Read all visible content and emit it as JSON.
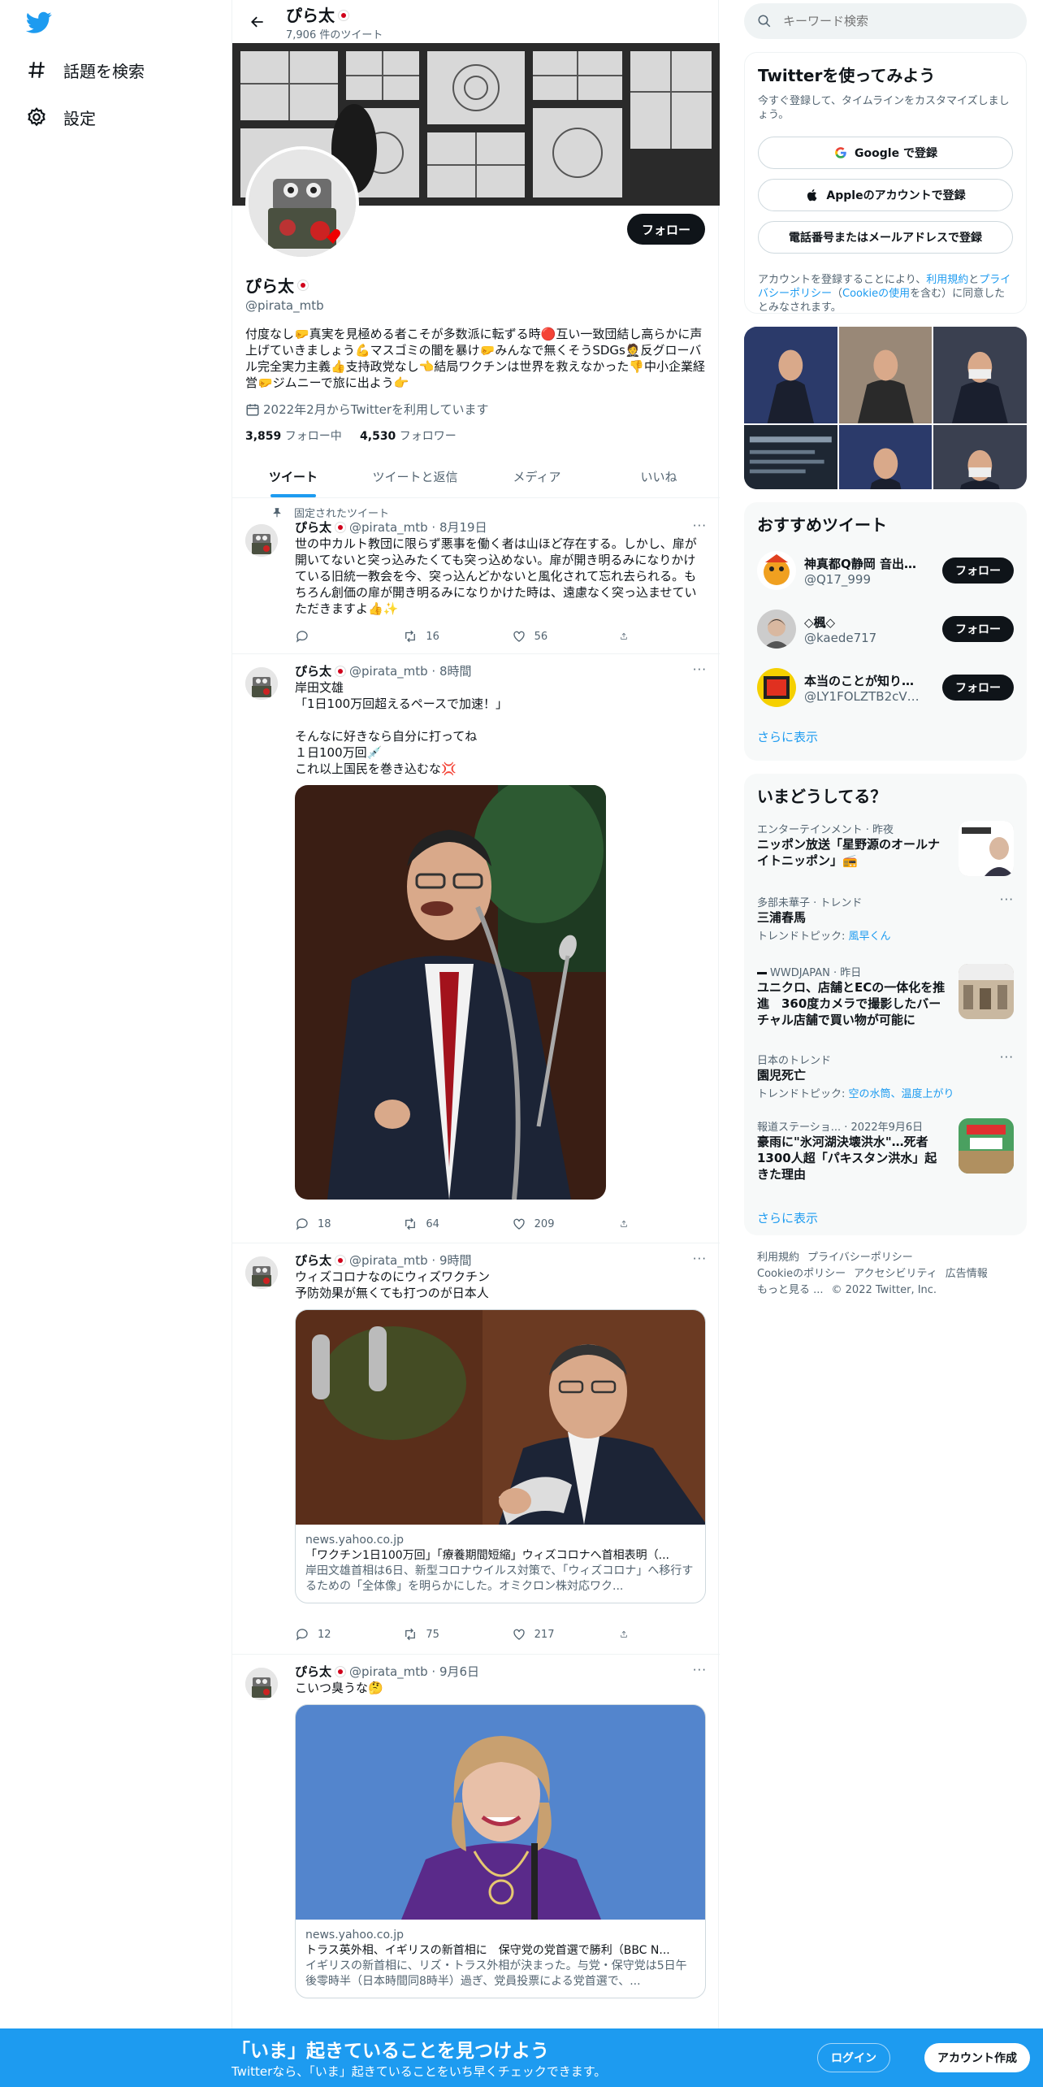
{
  "nav": {
    "explore_label": "話題を検索",
    "settings_label": "設定"
  },
  "profile": {
    "top_name": "ぴら太",
    "tweet_count": "7,906 件のツイート",
    "follow_label": "フォロー",
    "name": "ぴら太",
    "handle": "@pirata_mtb",
    "bio": "付度なし🤛真実を見極める者こそが多数派に転ずる時🔴互い一致団結し高らかに声上げていきましょう💪マスゴミの闇を暴け🤛みんなで無くそうSDGs🤵反グローバル完全実力主義👍支持政党なし👈結局ワクチンは世界を救えなかった👎中小企業経営🤛ジムニーで旅に出よう👉",
    "joined": "2022年2月からTwitterを利用しています",
    "following_count": "3,859",
    "following_label": "フォロー中",
    "followers_count": "4,530",
    "followers_label": "フォロワー"
  },
  "tabs": [
    "ツイート",
    "ツイートと返信",
    "メディア",
    "いいね"
  ],
  "tweets": [
    {
      "pinned_label": "固定されたツイート",
      "name": "ぴら太",
      "meta": "@pirata_mtb · 8月19日",
      "text": "世の中カルト教団に限らず悪事を働く者は山ほど存在する。しかし、扉が開いてないと突っ込みたくても突っ込めない。扉が開き明るみになりかけている旧統一教会を今、突っ込んどかないと風化されて忘れ去られる。もちろん創価の扉が開き明るみになりかけた時は、遠慮なく突っ込ませていただきますよ👍✨",
      "replies": "",
      "retweets": "16",
      "likes": "56"
    },
    {
      "name": "ぴら太",
      "meta": "@pirata_mtb · 8時間",
      "text": "岸田文雄\n「1日100万回超えるペースで加速！」\n\nそんなに好きなら自分に打ってね\n１日100万回💉\nこれ以上国民を巻き込むな💢",
      "replies": "18",
      "retweets": "64",
      "likes": "209"
    },
    {
      "name": "ぴら太",
      "meta": "@pirata_mtb · 9時間",
      "text": "ウィズコロナなのにウィズワクチン\n予防効果が無くても打つのが日本人",
      "card_domain": "news.yahoo.co.jp",
      "card_title": "「ワクチン1日100万回」「療養期間短縮」ウィズコロナへ首相表明（...",
      "card_desc": "岸田文雄首相は6日、新型コロナウイルス対策で、「ウィズコロナ」へ移行するための「全体像」を明らかにした。オミクロン株対応ワク...",
      "replies": "12",
      "retweets": "75",
      "likes": "217"
    },
    {
      "name": "ぴら太",
      "meta": "@pirata_mtb · 9月6日",
      "text": "こいつ臭うな🤔",
      "card_domain": "news.yahoo.co.jp",
      "card_title": "トラス英外相、イギリスの新首相に　保守党の党首選で勝利（BBC N...",
      "card_desc": "イギリスの新首相に、リズ・トラス外相が決まった。与党・保守党は5日午後零時半（日本時間同8時半）過ぎ、党員投票による党首選で、..."
    }
  ],
  "search": {
    "placeholder": "キーワード検索"
  },
  "signup": {
    "title": "Twitterを使ってみよう",
    "subtitle": "今すぐ登録して、タイムラインをカスタマイズしましょう。",
    "google_label": "Google で登録",
    "apple_label": "Appleのアカウントで登録",
    "phone_label": "電話番号またはメールアドレスで登録",
    "legal_prefix": "アカウントを登録することにより、",
    "legal_terms": "利用規約",
    "legal_and": "と",
    "legal_privacy": "プライバシーポリシー",
    "legal_paren_open": "（",
    "legal_cookie": "Cookieの使用",
    "legal_suffix": "を含む）に同意したとみなされます。"
  },
  "recommend": {
    "title": "おすすめツイート",
    "users": [
      {
        "name": "神真都Q静岡 音出し隊",
        "handle": "@Q17_999"
      },
      {
        "name": "◇楓◇",
        "handle": "@kaede717"
      },
      {
        "name": "本当のことが知りた...",
        "handle": "@LY1FOLZTB2cVC..."
      }
    ],
    "follow_label": "フォロー",
    "show_more": "さらに表示"
  },
  "trends": {
    "title": "いまどうしてる？",
    "items": [
      {
        "context": "エンターテインメント · 昨夜",
        "title": "ニッポン放送「星野源のオールナイトニッポン」📻"
      },
      {
        "context": "多部未華子 · トレンド",
        "title": "三浦春馬",
        "topic_prefix": "トレンドトピック: ",
        "topic": "風早くん"
      },
      {
        "context": "WWDJAPAN · 昨日",
        "title": "ユニクロ、店舗とECの一体化を推進　360度カメラで撮影したバーチャル店舗で買い物が可能に"
      },
      {
        "context": "日本のトレンド",
        "title": "園児死亡",
        "topic_prefix": "トレンドトピック: ",
        "topic": "空の水筒、温度上がり"
      },
      {
        "context": "報道ステーショ... · 2022年9月6日",
        "title": "豪雨に\"氷河湖決壊洪水\"…死者1300人超「パキスタン洪水」起きた理由"
      }
    ],
    "show_more": "さらに表示"
  },
  "footer": {
    "terms": "利用規約",
    "privacy": "プライバシーポリシー",
    "cookie": "Cookieのポリシー",
    "accessibility": "アクセシビリティ",
    "ads": "広告情報",
    "more": "もっと見る ...",
    "copyright": "© 2022 Twitter, Inc."
  },
  "bottom": {
    "title": "「いま」起きていることを見つけよう",
    "subtitle": "Twitterなら、「いま」起きていることをいち早くチェックできます。",
    "login": "ログイン",
    "signup": "アカウント作成"
  },
  "colors": {
    "accent": "#1d9bf0",
    "dark": "#0f1419",
    "muted": "#536471"
  }
}
